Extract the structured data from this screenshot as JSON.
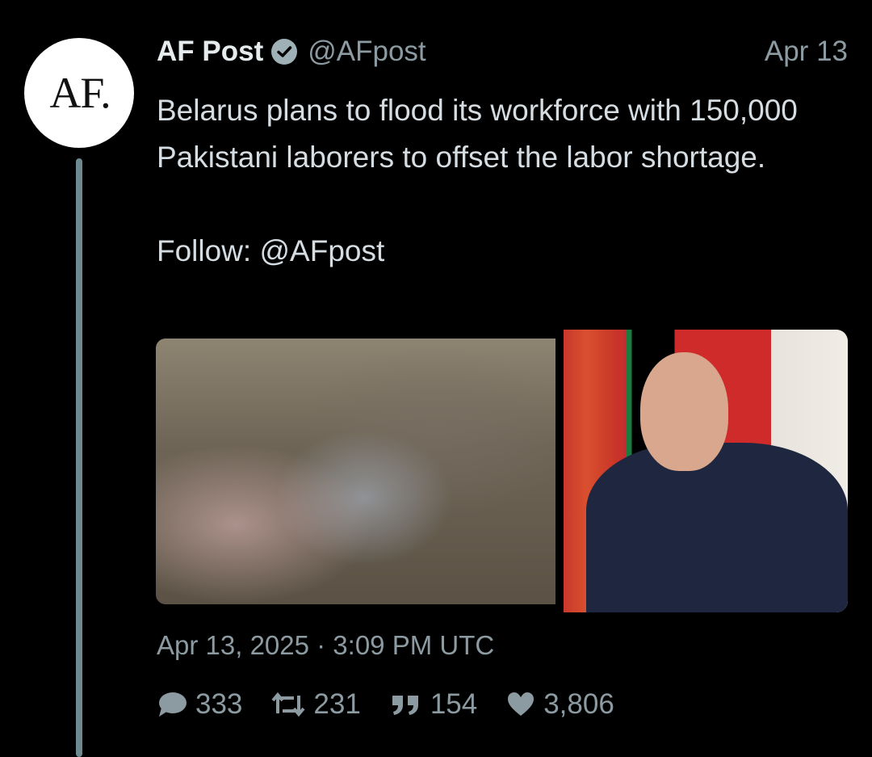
{
  "author": {
    "avatar_text": "AF.",
    "name": "AF Post",
    "handle": "@AFpost",
    "verified_icon": "verified-check-icon"
  },
  "post": {
    "date_short": "Apr 13",
    "text": "Belarus plans to flood its workforce with 150,000 Pakistani laborers to offset the labor shortage.",
    "follow_prefix": "Follow: ",
    "follow_mention": "@AFpost",
    "timestamp": "Apr 13, 2025 · 3:09 PM UTC"
  },
  "media": [
    {
      "description_icon": "photo-group-of-men-icon"
    },
    {
      "description_icon": "photo-man-clapping-icon"
    }
  ],
  "stats": {
    "replies": "333",
    "reposts": "231",
    "quotes": "154",
    "likes": "3,806"
  },
  "colors": {
    "background": "#000000",
    "text": "#d6dde2",
    "muted": "#8c9aa1",
    "thread_line": "#6e8a90"
  }
}
